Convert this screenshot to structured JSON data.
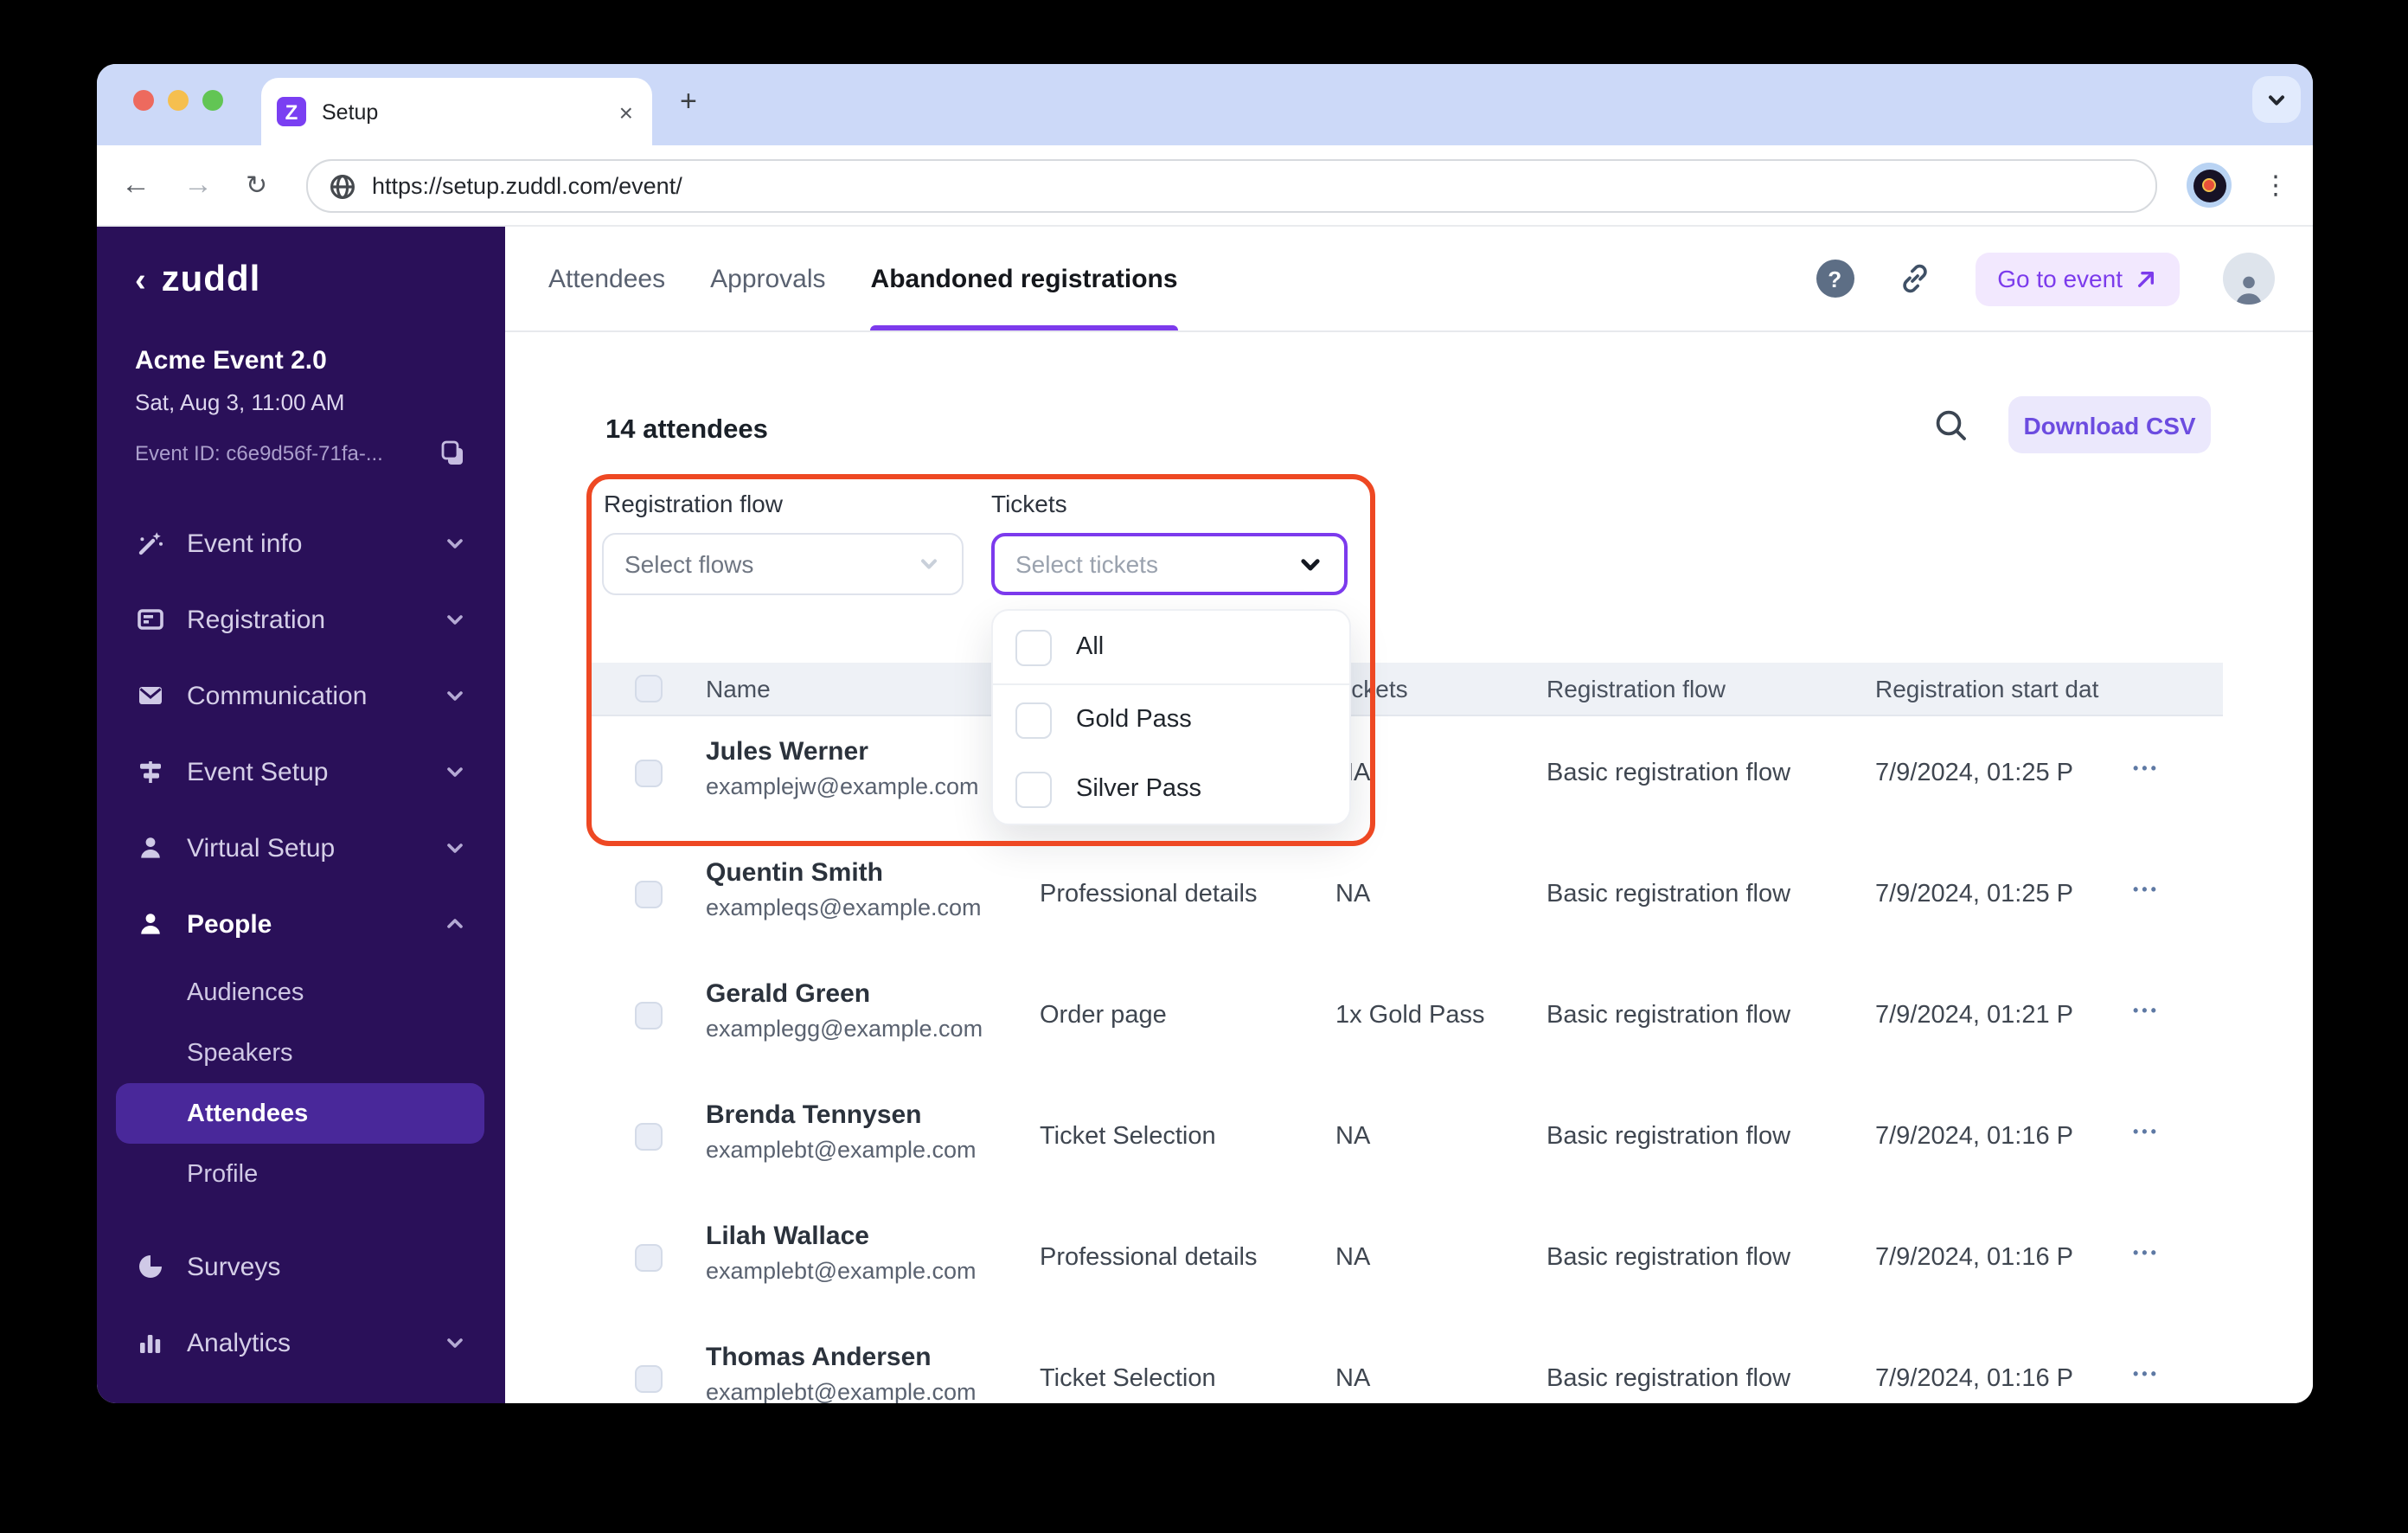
{
  "colors": {
    "accent_purple": "#7c3aed",
    "sidebar_bg": "#2a1059",
    "sidebar_active": "#49289a",
    "annotation_red": "#ee4823",
    "tabstrip": "#ccd9f8",
    "header_row": "#eef1f6",
    "go_to_event_bg": "#f2e8fe",
    "download_bg": "#ebe8fc"
  },
  "browser": {
    "tab_title": "Setup",
    "favicon_letter": "Z",
    "url": "https://setup.zuddl.com/event/",
    "back_glyph": "←",
    "forward_glyph": "→",
    "reload_glyph": "↻",
    "close_glyph": "×",
    "newtab_glyph": "+",
    "kebab_glyph": "⋮"
  },
  "sidebar": {
    "logo_back_glyph": "‹",
    "logo_text": "zuddl",
    "event_name": "Acme Event 2.0",
    "event_date": "Sat, Aug 3, 11:00 AM",
    "event_id": "Event ID: c6e9d56f-71fa-...",
    "nav": [
      {
        "label": "Event info"
      },
      {
        "label": "Registration"
      },
      {
        "label": "Communication"
      },
      {
        "label": "Event Setup"
      },
      {
        "label": "Virtual Setup"
      },
      {
        "label": "People"
      }
    ],
    "people_sub": [
      {
        "label": "Audiences"
      },
      {
        "label": "Speakers"
      },
      {
        "label": "Attendees"
      },
      {
        "label": "Profile"
      }
    ],
    "active_sub": "Attendees",
    "footer_nav": [
      {
        "label": "Surveys"
      },
      {
        "label": "Analytics"
      }
    ]
  },
  "header": {
    "tabs": [
      {
        "label": "Attendees"
      },
      {
        "label": "Approvals"
      },
      {
        "label": "Abandoned registrations"
      }
    ],
    "active_tab": "Abandoned registrations",
    "go_to_event_label": "Go to event"
  },
  "toolbar": {
    "attendee_count": "14 attendees",
    "download_csv_label": "Download CSV"
  },
  "filters": {
    "registration_flow_label": "Registration flow",
    "registration_flow_placeholder": "Select flows",
    "tickets_label": "Tickets",
    "tickets_placeholder": "Select tickets",
    "tickets_options": [
      {
        "label": "All"
      },
      {
        "label": "Gold Pass"
      },
      {
        "label": "Silver Pass"
      }
    ]
  },
  "table": {
    "headers": {
      "name": "Name",
      "tickets": "Tickets",
      "flow": "Registration flow",
      "start": "Registration start dat"
    },
    "rows": [
      {
        "name": "Jules Werner",
        "email": "examplejw@example.com",
        "drop_off": "",
        "tickets": "NA",
        "flow": "Basic registration flow",
        "start": "7/9/2024, 01:25 P"
      },
      {
        "name": "Quentin Smith",
        "email": "exampleqs@example.com",
        "drop_off": "Professional details",
        "tickets": "NA",
        "flow": "Basic registration flow",
        "start": "7/9/2024, 01:25 P"
      },
      {
        "name": "Gerald Green",
        "email": "examplegg@example.com",
        "drop_off": "Order page",
        "tickets": "1x Gold Pass",
        "flow": "Basic registration flow",
        "start": "7/9/2024, 01:21 P"
      },
      {
        "name": "Brenda Tennysen",
        "email": "examplebt@example.com",
        "drop_off": "Ticket Selection",
        "tickets": "NA",
        "flow": "Basic registration flow",
        "start": "7/9/2024, 01:16 P"
      },
      {
        "name": "Lilah Wallace",
        "email": "examplebt@example.com",
        "drop_off": "Professional details",
        "tickets": "NA",
        "flow": "Basic registration flow",
        "start": "7/9/2024, 01:16 P"
      },
      {
        "name": "Thomas Andersen",
        "email": "examplebt@example.com",
        "drop_off": "Ticket Selection",
        "tickets": "NA",
        "flow": "Basic registration flow",
        "start": "7/9/2024, 01:16 P"
      }
    ],
    "row_menu_glyph": "•••"
  }
}
